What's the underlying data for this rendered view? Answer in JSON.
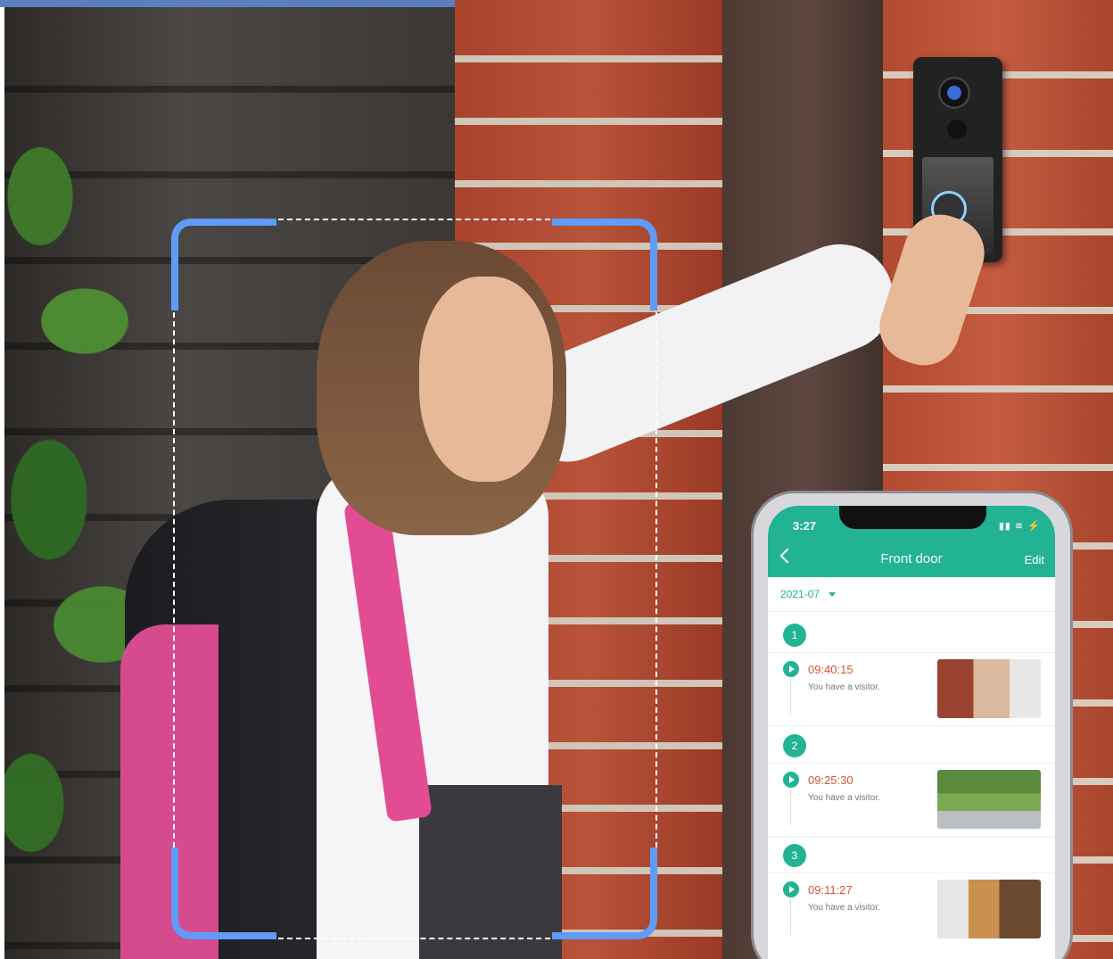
{
  "phone": {
    "status_time": "3:27",
    "status_icons": "▮▮ ≋ ⚡",
    "back_icon": "chevron-left-icon",
    "title": "Front door",
    "edit_label": "Edit",
    "month": "2021-07",
    "entries": [
      {
        "number": "1",
        "time": "09:40:15",
        "message": "You have a visitor."
      },
      {
        "number": "2",
        "time": "09:25:30",
        "message": "You have a visitor."
      },
      {
        "number": "3",
        "time": "09:11:27",
        "message": "You have a visitor."
      }
    ]
  },
  "colors": {
    "app_accent": "#22b394",
    "time_text": "#d9523a",
    "frame_corner": "#5f9cf7"
  }
}
